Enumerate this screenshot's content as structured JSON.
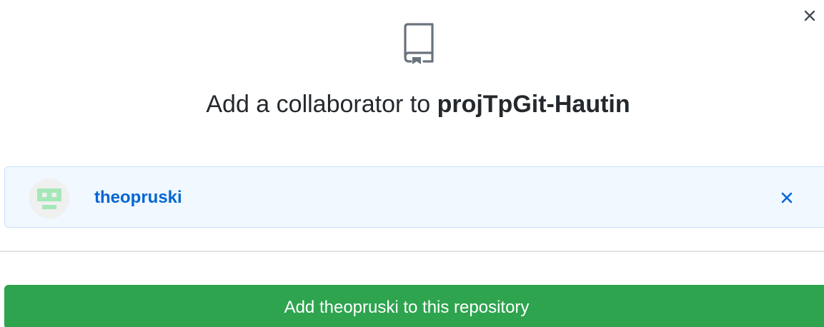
{
  "dialog": {
    "title_prefix": "Add a collaborator to",
    "repo_name": "projTpGit-Hautin",
    "icons": {
      "close": "close-icon",
      "repo": "repo-icon",
      "remove": "close-icon"
    }
  },
  "selected_user": {
    "username": "theopruski",
    "avatar": "identicon"
  },
  "actions": {
    "add_button_label": "Add theopruski to this repository"
  },
  "colors": {
    "button_green": "#2ea44f",
    "link_blue": "#0366d6",
    "selection_bg": "#f1f8ff",
    "selection_border": "#c8e1ff",
    "identicon_green": "#a4e8b8"
  }
}
